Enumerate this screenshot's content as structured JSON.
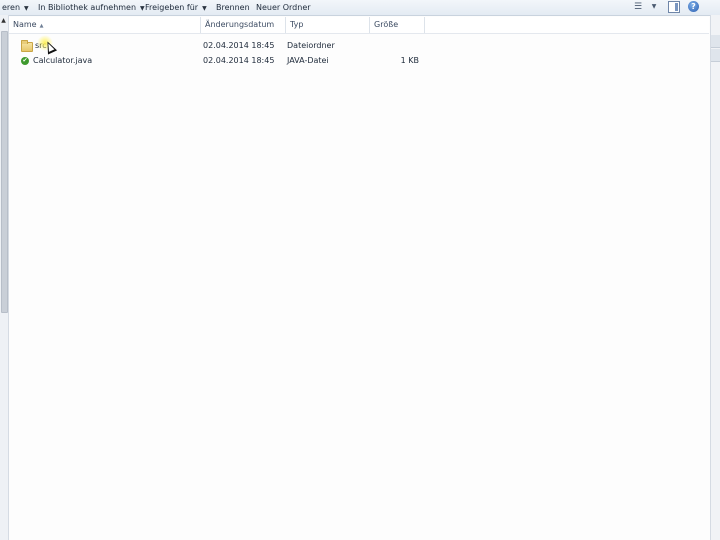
{
  "toolbar": {
    "items": [
      {
        "label": "eren",
        "has_arrow": true
      },
      {
        "label": "In Bibliothek aufnehmen",
        "has_arrow": true
      },
      {
        "label": "Freigeben für",
        "has_arrow": true
      },
      {
        "label": "Brennen",
        "has_arrow": false
      },
      {
        "label": "Neuer Ordner",
        "has_arrow": false
      }
    ],
    "icons": [
      "view-options-icon",
      "view-dropdown-icon",
      "preview-pane-icon",
      "help-icon"
    ],
    "help_glyph": "?"
  },
  "columns": [
    {
      "label": "Name",
      "sorted": true
    },
    {
      "label": "Änderungsdatum"
    },
    {
      "label": "Typ"
    },
    {
      "label": "Größe"
    }
  ],
  "rows": [
    {
      "name": "src",
      "date": "02.04.2014 18:45",
      "type": "Dateiordner",
      "size": "",
      "icon": "folder-icon"
    },
    {
      "name": "Calculator.java",
      "date": "02.04.2014 18:45",
      "type": "JAVA-Datei",
      "size": "1 KB",
      "icon": "java-file-icon"
    }
  ],
  "colors": {
    "toolbar_bg": "#e8eef5",
    "folder": "#e6c66a",
    "java_badge": "#3f9a2e",
    "cursor_highlight": "#fff050"
  }
}
